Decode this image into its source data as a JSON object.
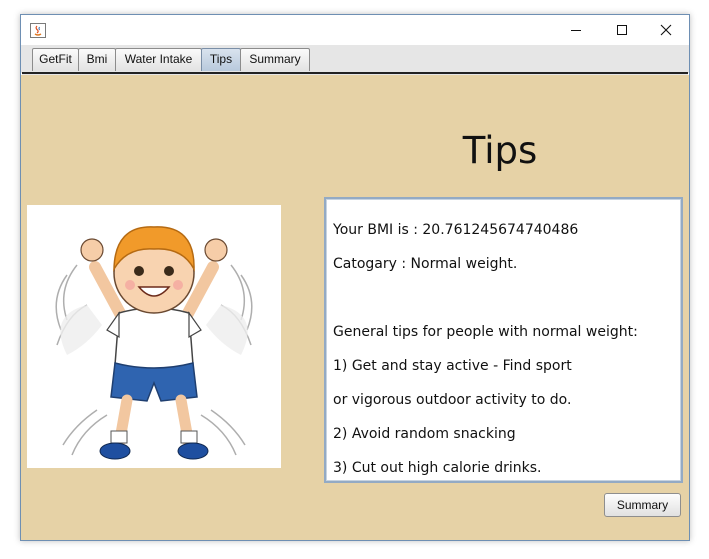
{
  "window": {
    "title": "",
    "controls": [
      "minimize-icon",
      "maximize-icon",
      "close-icon"
    ]
  },
  "tabs": [
    {
      "label": "GetFit",
      "selected": false
    },
    {
      "label": "Bmi",
      "selected": false
    },
    {
      "label": "Water Intake",
      "selected": false
    },
    {
      "label": "Tips",
      "selected": true
    },
    {
      "label": "Summary",
      "selected": false
    }
  ],
  "tips_panel": {
    "title": "Tips",
    "text_lines": [
      "Your BMI is : 20.761245674740486",
      "Catogary : Normal weight.",
      "",
      "General tips for people with normal weight:",
      "1) Get and stay active - Find sport",
      "or vigorous outdoor activity to do.",
      "2) Avoid random snacking",
      "3) Cut out high calorie drinks."
    ],
    "summary_button_label": "Summary"
  },
  "colors": {
    "panel_background": "#e6d2a6",
    "selected_tab": "#c4d3e3",
    "text_area_border": "#93aac4"
  }
}
